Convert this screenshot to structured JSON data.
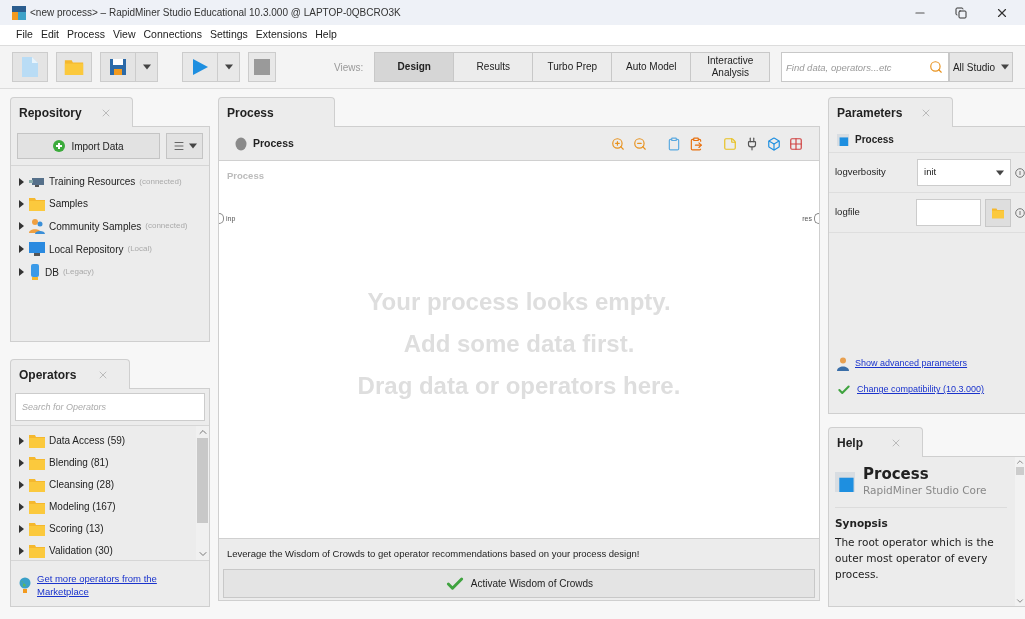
{
  "window": {
    "title": "<new process> – RapidMiner Studio Educational 10.3.000 @ LAPTOP-0QBCRO3K"
  },
  "menu": [
    {
      "label": "File"
    },
    {
      "label": "Edit"
    },
    {
      "label": "Process"
    },
    {
      "label": "View"
    },
    {
      "label": "Connections"
    },
    {
      "label": "Settings"
    },
    {
      "label": "Extensions"
    },
    {
      "label": "Help"
    }
  ],
  "toolbar": {
    "views_label": "Views:",
    "views": [
      {
        "label": "Design",
        "selected": true
      },
      {
        "label": "Results",
        "selected": false
      },
      {
        "label": "Turbo Prep",
        "selected": false
      },
      {
        "label": "Auto Model",
        "selected": false
      },
      {
        "label": "Interactive Analysis",
        "selected": false
      }
    ],
    "search": {
      "placeholder": "Find data, operators...etc"
    },
    "scope": "All Studio"
  },
  "repository": {
    "title": "Repository",
    "import_button": "Import Data",
    "items": [
      {
        "kind": "training",
        "name": "Training Resources",
        "note": "(connected)",
        "expanded": false
      },
      {
        "kind": "folder",
        "name": "Samples",
        "expanded": false
      },
      {
        "kind": "community",
        "name": "Community Samples",
        "note": "(connected)",
        "expanded": false
      },
      {
        "kind": "local",
        "name": "Local Repository",
        "note": "(Local)",
        "expanded": false
      },
      {
        "kind": "db",
        "name": "DB",
        "note": "(Legacy)",
        "expanded": false
      }
    ]
  },
  "operators": {
    "title": "Operators",
    "search": {
      "placeholder": "Search for Operators"
    },
    "items": [
      {
        "label": "Data Access (59)",
        "expanded": false
      },
      {
        "label": "Blending (81)",
        "expanded": false
      },
      {
        "label": "Cleansing (28)",
        "expanded": false
      },
      {
        "label": "Modeling (167)",
        "expanded": false
      },
      {
        "label": "Scoring (13)",
        "expanded": false
      },
      {
        "label": "Validation (30)",
        "expanded": false
      }
    ],
    "link": "Get more operators from the Marketplace"
  },
  "process": {
    "title": "Process",
    "breadcrumb": "Process",
    "canvas_label": "Process",
    "input_port": "inp",
    "output_port": "res",
    "empty_message": [
      "Your process looks empty.",
      "Add some data first.",
      "Drag data or operators here."
    ],
    "recommendation": "Leverage the Wisdom of Crowds to get operator recommendations based on your process design!",
    "activate_button": "Activate Wisdom of Crowds"
  },
  "parameters": {
    "title": "Parameters",
    "operator": "Process",
    "params": [
      {
        "kind": "select",
        "label": "logverbosity",
        "value": "init"
      },
      {
        "kind": "file",
        "label": "logfile"
      }
    ],
    "advanced_link": "Show advanced parameters",
    "compat_link": "Change compatibility (10.3.000)"
  },
  "help": {
    "title": "Help",
    "heading": "Process",
    "subtitle": "RapidMiner Studio Core",
    "section": "Synopsis",
    "text": "The root operator which is the outer most operator of every process."
  }
}
